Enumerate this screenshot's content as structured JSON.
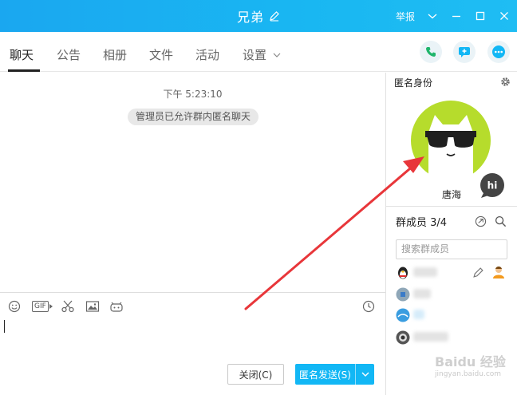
{
  "window": {
    "title": "兄弟",
    "report": "举报"
  },
  "tabs": [
    {
      "label": "聊天"
    },
    {
      "label": "公告"
    },
    {
      "label": "相册"
    },
    {
      "label": "文件"
    },
    {
      "label": "活动"
    },
    {
      "label": "设置"
    }
  ],
  "chat": {
    "time": "下午 5:23:10",
    "system_message": "管理员已允许群内匿名聊天"
  },
  "buttons": {
    "close": "关闭(C)",
    "send": "匿名发送(S)"
  },
  "anonymous": {
    "title": "匿名身份",
    "name": "唐海",
    "bubble": "hi"
  },
  "members": {
    "title": "群成员 3/4",
    "search_placeholder": "搜索群成员"
  },
  "watermark": {
    "brand": "Baidu 经验",
    "url": "jingyan.baidu.com"
  },
  "colors": {
    "titlebar": "#19b3f2",
    "send_button": "#12b7f5",
    "avatar_bg": "#b6dc2c",
    "arrow": "#e8363a"
  }
}
